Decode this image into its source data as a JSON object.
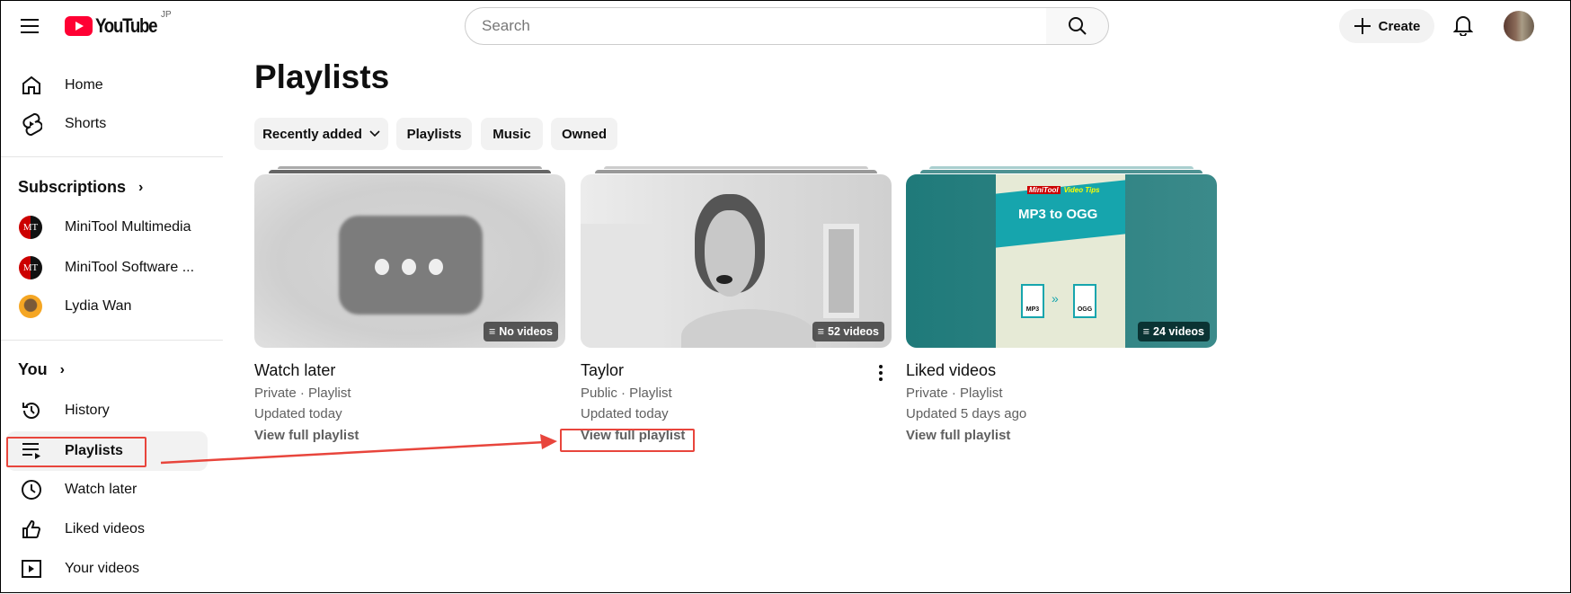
{
  "header": {
    "logo_text": "YouTube",
    "region": "JP",
    "search_placeholder": "Search",
    "create_label": "Create"
  },
  "sidebar": {
    "top": [
      {
        "label": "Home"
      },
      {
        "label": "Shorts"
      }
    ],
    "subscriptions_title": "Subscriptions",
    "subscriptions": [
      {
        "label": "MiniTool Multimedia",
        "initials": "MT"
      },
      {
        "label": "MiniTool Software ...",
        "initials": "MT"
      },
      {
        "label": "Lydia Wan"
      }
    ],
    "you_title": "You",
    "you": [
      {
        "label": "History"
      },
      {
        "label": "Playlists"
      },
      {
        "label": "Watch later"
      },
      {
        "label": "Liked videos"
      },
      {
        "label": "Your videos"
      }
    ]
  },
  "main": {
    "title": "Playlists",
    "chips": [
      {
        "label": "Recently added"
      },
      {
        "label": "Playlists"
      },
      {
        "label": "Music"
      },
      {
        "label": "Owned"
      }
    ],
    "cards": [
      {
        "title": "Watch later",
        "visibility": "Private · Playlist",
        "updated": "Updated today",
        "count": "No videos",
        "action": "View full playlist"
      },
      {
        "title": "Taylor",
        "visibility": "Public · Playlist",
        "updated": "Updated today",
        "count": "52 videos",
        "action": "View full playlist"
      },
      {
        "title": "Liked videos",
        "visibility": "Private · Playlist",
        "updated": "Updated 5 days ago",
        "count": "24 videos",
        "action": "View full playlist",
        "thumb_brand": "MiniTool",
        "thumb_subtitle": "Video Tips",
        "thumb_heading": "MP3 to OGG",
        "thumb_from": "MP3",
        "thumb_to": "OGG"
      }
    ]
  },
  "colors": {
    "accent_red": "#ff0033",
    "annotation_red": "#e8453c",
    "teal": "#2f7f7f"
  }
}
